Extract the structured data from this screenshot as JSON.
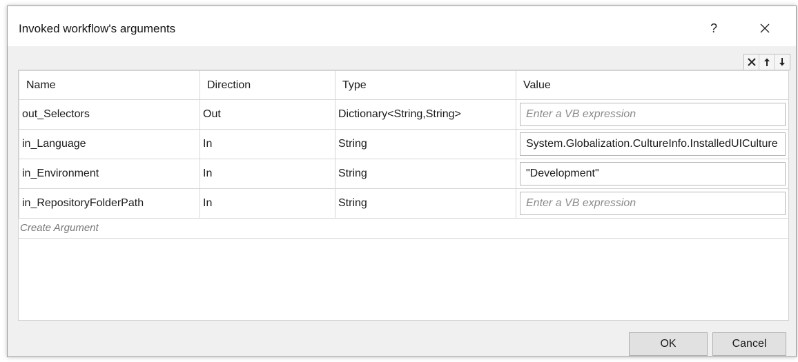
{
  "dialog": {
    "title": "Invoked workflow's arguments",
    "help_label": "?"
  },
  "toolbar": {
    "icons": [
      "delete-icon",
      "move-up-icon",
      "move-down-icon"
    ]
  },
  "grid": {
    "columns": [
      "Name",
      "Direction",
      "Type",
      "Value"
    ],
    "rows": [
      {
        "name": "out_Selectors",
        "direction": "Out",
        "type": "Dictionary<String,String>",
        "value": "",
        "placeholder": "Enter a VB expression"
      },
      {
        "name": "in_Language",
        "direction": "In",
        "type": "String",
        "value": "System.Globalization.CultureInfo.InstalledUICulture",
        "placeholder": ""
      },
      {
        "name": "in_Environment",
        "direction": "In",
        "type": "String",
        "value": "\"Development\"",
        "placeholder": ""
      },
      {
        "name": "in_RepositoryFolderPath",
        "direction": "In",
        "type": "String",
        "value": "",
        "placeholder": "Enter a VB expression"
      }
    ],
    "create_label": "Create Argument"
  },
  "buttons": {
    "ok": "OK",
    "cancel": "Cancel"
  },
  "colors": {
    "dialog_bg": "#f0f0f0",
    "grid_border": "#d6d6d6",
    "placeholder": "#8a8a8a"
  }
}
